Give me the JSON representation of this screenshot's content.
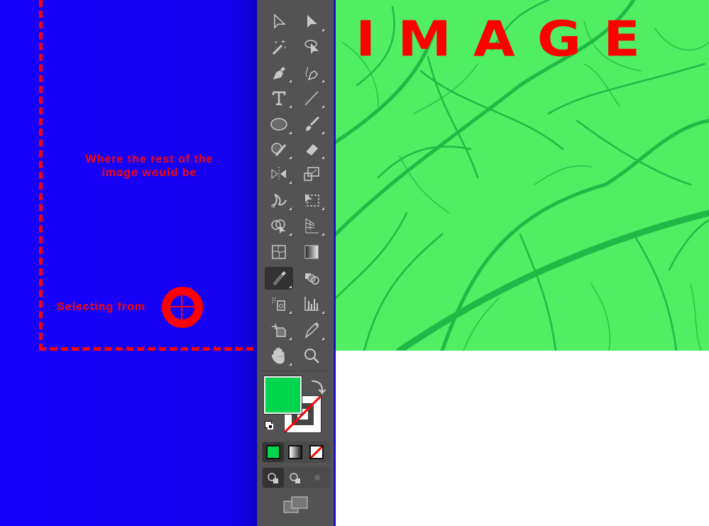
{
  "annotations": {
    "rest_of_image": "Where the rest of the image would be",
    "selecting_from": "Selecting from"
  },
  "canvas": {
    "image_title": "IMAGE"
  },
  "colors": {
    "fill": "#00d54f",
    "stroke": "none",
    "annotation": "#ff0000",
    "background": "#1400f5",
    "image_tint": "#4fee63"
  },
  "toolbar": {
    "tools": [
      [
        "selection-tool",
        "direct-selection-tool"
      ],
      [
        "magic-wand-tool",
        "lasso-tool"
      ],
      [
        "pen-tool",
        "curvature-tool"
      ],
      [
        "type-tool",
        "line-segment-tool"
      ],
      [
        "ellipse-tool",
        "paintbrush-tool"
      ],
      [
        "shaper-tool",
        "eraser-tool"
      ],
      [
        "reflect-tool",
        "scale-tool"
      ],
      [
        "puppet-warp-tool",
        "free-transform-tool"
      ],
      [
        "shape-builder-tool",
        "perspective-grid-tool"
      ],
      [
        "mesh-tool",
        "gradient-tool"
      ],
      [
        "eyedropper-tool",
        "blend-tool"
      ],
      [
        "symbol-sprayer-tool",
        "column-graph-tool"
      ],
      [
        "artboard-tool",
        "slice-tool"
      ],
      [
        "hand-tool",
        "zoom-tool"
      ]
    ],
    "active_tool": "eyedropper-tool"
  }
}
